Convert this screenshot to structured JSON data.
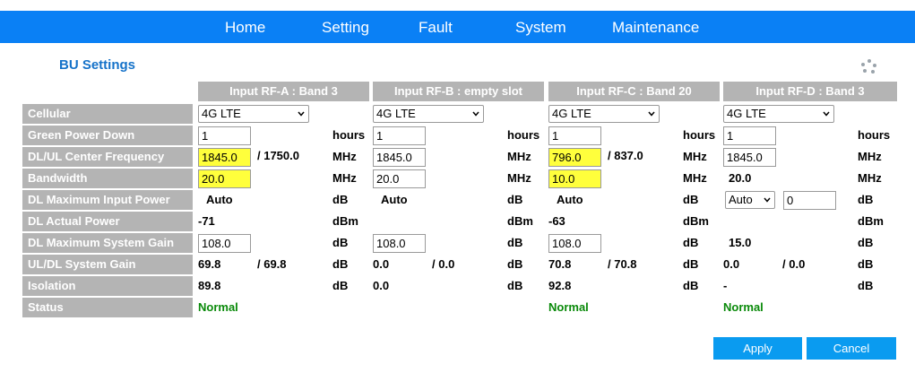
{
  "nav": [
    "Home",
    "Setting",
    "Fault",
    "System",
    "Maintenance"
  ],
  "title": "BU Settings",
  "columns": [
    {
      "header": "Input RF-A : Band 3",
      "cellular": "4G LTE",
      "green_power_down": "1",
      "hours": "hours",
      "freq": "1845.0",
      "freq_ul": "/ 1750.0",
      "freq_unit": "MHz",
      "bandwidth": "20.0",
      "bw_unit": "MHz",
      "dl_max_input": "Auto",
      "dl_max_input_unit": "dB",
      "dl_actual": "-71",
      "dl_actual_unit": "dBm",
      "dl_max_gain": "108.0",
      "dl_max_gain_unit": "dB",
      "ul_gain": "69.8",
      "dl_gain": "/ 69.8",
      "sys_gain_unit": "dB",
      "isolation": "89.8",
      "isolation_unit": "dB",
      "status": "Normal"
    },
    {
      "header": "Input RF-B : empty slot",
      "cellular": "4G LTE",
      "green_power_down": "1",
      "hours": "hours",
      "freq": "1845.0",
      "freq_ul": "",
      "freq_unit": "MHz",
      "bandwidth": "20.0",
      "bw_unit": "MHz",
      "dl_max_input": "Auto",
      "dl_max_input_unit": "dB",
      "dl_actual": "",
      "dl_actual_unit": "dBm",
      "dl_max_gain": "108.0",
      "dl_max_gain_unit": "dB",
      "ul_gain": "0.0",
      "dl_gain": "/ 0.0",
      "sys_gain_unit": "dB",
      "isolation": "0.0",
      "isolation_unit": "dB",
      "status": ""
    },
    {
      "header": "Input RF-C : Band 20",
      "cellular": "4G LTE",
      "green_power_down": "1",
      "hours": "hours",
      "freq": "796.0",
      "freq_ul": "/ 837.0",
      "freq_unit": "MHz",
      "bandwidth": "10.0",
      "bw_unit": "MHz",
      "dl_max_input": "Auto",
      "dl_max_input_unit": "dB",
      "dl_actual": "-63",
      "dl_actual_unit": "dBm",
      "dl_max_gain": "108.0",
      "dl_max_gain_unit": "dB",
      "ul_gain": "70.8",
      "dl_gain": "/ 70.8",
      "sys_gain_unit": "dB",
      "isolation": "92.8",
      "isolation_unit": "dB",
      "status": "Normal"
    },
    {
      "header": "Input RF-D : Band 3",
      "cellular": "4G LTE",
      "green_power_down": "1",
      "hours": "hours",
      "freq": "1845.0",
      "freq_ul": "",
      "freq_unit": "MHz",
      "bandwidth": "20.0",
      "bw_unit": "MHz",
      "dl_max_input": "Auto",
      "dl_max_input_extra": "0",
      "dl_max_input_unit": "dB",
      "dl_actual": "",
      "dl_actual_unit": "dBm",
      "dl_max_gain": "15.0",
      "dl_max_gain_unit": "dB",
      "ul_gain": "0.0",
      "dl_gain": "/ 0.0",
      "sys_gain_unit": "dB",
      "isolation": "-",
      "isolation_unit": "dB",
      "status": "Normal"
    }
  ],
  "rows": [
    "Cellular",
    "Green Power Down",
    "DL/UL Center Frequency",
    "Bandwidth",
    "DL Maximum Input Power",
    "DL Actual Power",
    "DL Maximum System Gain",
    "UL/DL System Gain",
    "Isolation",
    "Status"
  ],
  "buttons": {
    "apply": "Apply",
    "cancel": "Cancel"
  },
  "colors": {
    "nav": "#0a80f5",
    "header": "#b4b4b4",
    "highlight": "#ffff3c",
    "status_ok": "#0a8a0a",
    "button": "#0a9bf0"
  }
}
